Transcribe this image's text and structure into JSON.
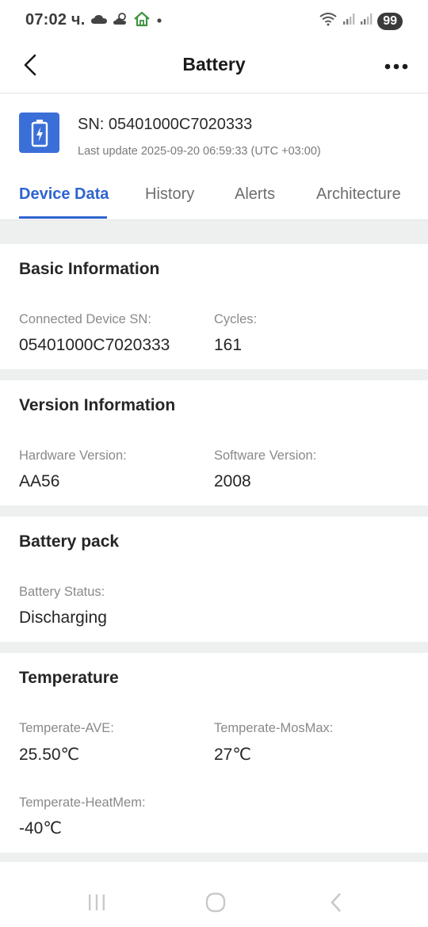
{
  "status_bar": {
    "time": "07:02 ч.",
    "battery_level": "99",
    "icons_left": [
      "cloud-icon",
      "partly-cloudy-icon",
      "home-icon",
      "dot-icon"
    ],
    "icons_right": [
      "wifi-icon",
      "signal-icon",
      "signal-icon-2",
      "battery-icon"
    ]
  },
  "header": {
    "title": "Battery",
    "back_icon": "chevron-left-icon",
    "more_icon": "more-dots-icon"
  },
  "device": {
    "icon": "battery-charging-icon",
    "sn": "SN: 05401000C7020333",
    "last_update": "Last update 2025-09-20 06:59:33 (UTC +03:00)"
  },
  "tabs": [
    {
      "label": "Device Data",
      "active": true
    },
    {
      "label": "History",
      "active": false
    },
    {
      "label": "Alerts",
      "active": false
    },
    {
      "label": "Architecture",
      "active": false
    }
  ],
  "sections": {
    "basic": {
      "title": "Basic Information",
      "connected_sn_label": "Connected Device SN:",
      "connected_sn_value": "05401000C7020333",
      "cycles_label": "Cycles:",
      "cycles_value": "161"
    },
    "version": {
      "title": "Version Information",
      "hardware_label": "Hardware Version:",
      "hardware_value": "AA56",
      "software_label": "Software Version:",
      "software_value": "2008"
    },
    "pack": {
      "title": "Battery pack",
      "status_label": "Battery Status:",
      "status_value": "Discharging"
    },
    "temperature": {
      "title": "Temperature",
      "ave_label": "Temperate-AVE:",
      "ave_value": "25.50℃",
      "mosmax_label": "Temperate-MosMax:",
      "mosmax_value": "27℃",
      "heatmem_label": "Temperate-HeatMem:",
      "heatmem_value": "-40℃"
    }
  },
  "nav_bar": {
    "icons": [
      "recent-apps-icon",
      "home-circle-icon",
      "back-nav-icon"
    ]
  },
  "colors": {
    "accent": "#2f64d0",
    "device_icon_bg": "#3b6fd8",
    "section_gap": "#eef0f0"
  }
}
